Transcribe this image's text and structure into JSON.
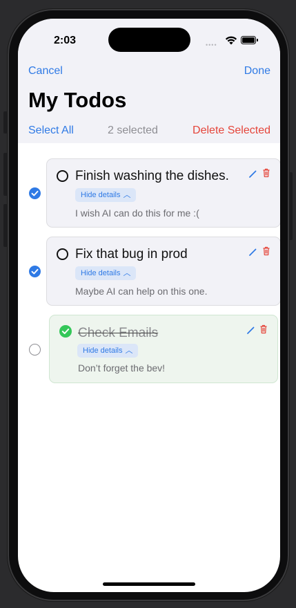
{
  "status_bar": {
    "time": "2:03"
  },
  "nav": {
    "cancel_label": "Cancel",
    "done_label": "Done"
  },
  "page": {
    "title": "My Todos"
  },
  "toolbar": {
    "select_all_label": "Select All",
    "selected_count_label": "2 selected",
    "delete_selected_label": "Delete Selected"
  },
  "todos": [
    {
      "title": "Finish washing the dishes.",
      "note": "I wish AI can do this for me :(",
      "toggle_label": "Hide details",
      "selected": true,
      "completed": false
    },
    {
      "title": "Fix that bug in prod",
      "note": "Maybe AI can help on this one.",
      "toggle_label": "Hide details",
      "selected": true,
      "completed": false
    },
    {
      "title": "Check Emails",
      "note": "Don’t forget the bev!",
      "toggle_label": "Hide details",
      "selected": false,
      "completed": true
    }
  ],
  "icons": {
    "edit": "pencil-icon",
    "delete": "trash-icon",
    "selected": "checkmark-circle-icon",
    "completed": "checkmark-circle-filled-icon"
  },
  "colors": {
    "accent": "#2f7ae5",
    "destructive": "#e5453a",
    "completed": "#34c759",
    "header_background": "#f2f2f7"
  }
}
